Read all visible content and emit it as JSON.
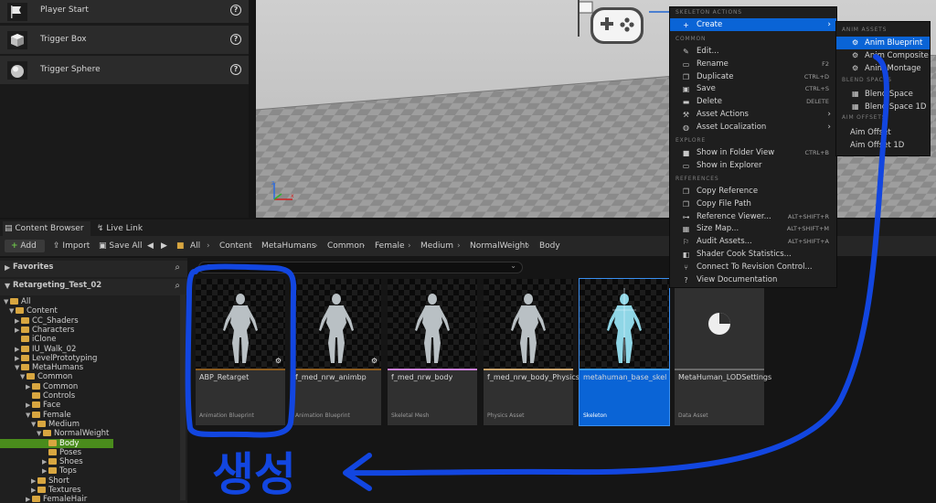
{
  "actors": [
    {
      "label": "Player Start",
      "icon": "flag-icon"
    },
    {
      "label": "Trigger Box",
      "icon": "cube-icon"
    },
    {
      "label": "Trigger Sphere",
      "icon": "sphere-icon"
    }
  ],
  "tabs": {
    "content_browser": "Content Browser",
    "live_link": "Live Link"
  },
  "toolbar": {
    "add": "Add",
    "import": "Import",
    "save_all": "Save All"
  },
  "breadcrumbs": [
    "All",
    "Content",
    "MetaHumans",
    "Common",
    "Female",
    "Medium",
    "NormalWeight",
    "Body"
  ],
  "favorites_label": "Favorites",
  "project_label": "Retargeting_Test_02",
  "tree": [
    "All",
    "Content",
    "CC_Shaders",
    "Characters",
    "iClone",
    "IU_Walk_02",
    "LevelPrototyping",
    "MetaHumans",
    "Common",
    "Common",
    "Controls",
    "Face",
    "Female",
    "Medium",
    "NormalWeight",
    "Body",
    "Poses",
    "Shoes",
    "Tops",
    "Short",
    "Textures",
    "FemaleHair"
  ],
  "assets": [
    {
      "name": "ABP_Retarget",
      "type": "Animation Blueprint",
      "bar_color": "#8a5a1e"
    },
    {
      "name": "f_med_nrw_animbp",
      "type": "Animation Blueprint",
      "bar_color": "#8a5a1e"
    },
    {
      "name": "f_med_nrw_body",
      "type": "Skeletal Mesh",
      "bar_color": "#c97fd6"
    },
    {
      "name": "f_med_nrw_body_Physics",
      "type": "Physics Asset",
      "bar_color": "#c9a26a"
    },
    {
      "name": "metahuman_base_skel",
      "type": "Skeleton",
      "bar_color": "#3a9ae8"
    },
    {
      "name": "MetaHuman_LODSettings",
      "type": "Data Asset",
      "bar_color": "#6a6a6a"
    }
  ],
  "context_menu": {
    "sections": {
      "skeleton_actions": "SKELETON ACTIONS",
      "common": "COMMON",
      "explore": "EXPLORE",
      "references": "REFERENCES"
    },
    "create": "Create",
    "common_items": [
      {
        "label": "Edit...",
        "shortcut": "",
        "sub": ""
      },
      {
        "label": "Rename",
        "shortcut": "F2",
        "sub": ""
      },
      {
        "label": "Duplicate",
        "shortcut": "CTRL+D",
        "sub": ""
      },
      {
        "label": "Save",
        "shortcut": "CTRL+S",
        "sub": ""
      },
      {
        "label": "Delete",
        "shortcut": "DELETE",
        "sub": ""
      },
      {
        "label": "Asset Actions",
        "shortcut": "",
        "sub": "›"
      },
      {
        "label": "Asset Localization",
        "shortcut": "",
        "sub": "›"
      }
    ],
    "explore_items": [
      {
        "label": "Show in Folder View",
        "shortcut": "CTRL+B"
      },
      {
        "label": "Show in Explorer",
        "shortcut": ""
      }
    ],
    "reference_items": [
      {
        "label": "Copy Reference",
        "shortcut": ""
      },
      {
        "label": "Copy File Path",
        "shortcut": ""
      },
      {
        "label": "Reference Viewer...",
        "shortcut": "ALT+SHIFT+R"
      },
      {
        "label": "Size Map...",
        "shortcut": "ALT+SHIFT+M"
      },
      {
        "label": "Audit Assets...",
        "shortcut": "ALT+SHIFT+A"
      },
      {
        "label": "Shader Cook Statistics...",
        "shortcut": ""
      },
      {
        "label": "Connect To Revision Control...",
        "shortcut": ""
      },
      {
        "label": "View Documentation",
        "shortcut": ""
      }
    ]
  },
  "sub_menu": {
    "sections": {
      "anim_assets": "ANIM ASSETS",
      "blend_spaces": "BLEND SPACES",
      "aim_offsets": "AIM OFFSETS"
    },
    "items": [
      "Anim Blueprint",
      "Anim Composite",
      "Anim Montage",
      "Blend Space",
      "Blend Space 1D",
      "Aim Offset",
      "Aim Offset 1D"
    ]
  },
  "annotation_text": "생성",
  "colors": {
    "accent_blue": "#0a64d6",
    "annotation_blue": "#1246e0",
    "selected_green": "#4a8c1c"
  }
}
